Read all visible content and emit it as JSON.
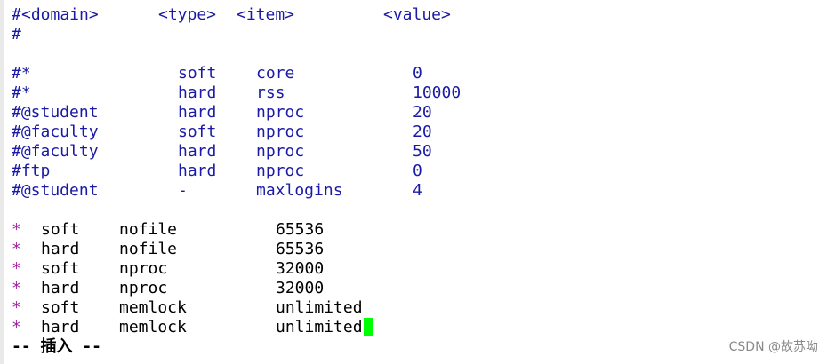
{
  "editor": {
    "partial_top": "#",
    "header": {
      "hash": "#",
      "domain": "<domain>",
      "type": "<type>",
      "item": "<item>",
      "value": "<value>"
    },
    "hash_line": "#",
    "commented_rows": [
      {
        "domain": "#*",
        "type": "soft",
        "item": "core",
        "value": "0"
      },
      {
        "domain": "#*",
        "type": "hard",
        "item": "rss",
        "value": "10000"
      },
      {
        "domain": "#@student",
        "type": "hard",
        "item": "nproc",
        "value": "20"
      },
      {
        "domain": "#@faculty",
        "type": "soft",
        "item": "nproc",
        "value": "20"
      },
      {
        "domain": "#@faculty",
        "type": "hard",
        "item": "nproc",
        "value": "50"
      },
      {
        "domain": "#ftp",
        "type": "hard",
        "item": "nproc",
        "value": "0"
      },
      {
        "domain": "#@student",
        "type": "-",
        "item": "maxlogins",
        "value": "4"
      }
    ],
    "active_rows": [
      {
        "domain": "*",
        "type": "soft",
        "item": "nofile",
        "value": "65536"
      },
      {
        "domain": "*",
        "type": "hard",
        "item": "nofile",
        "value": "65536"
      },
      {
        "domain": "*",
        "type": "soft",
        "item": "nproc",
        "value": "32000"
      },
      {
        "domain": "*",
        "type": "hard",
        "item": "nproc",
        "value": "32000"
      },
      {
        "domain": "*",
        "type": "soft",
        "item": "memlock",
        "value": "unlimited"
      },
      {
        "domain": "*",
        "type": "hard",
        "item": "memlock",
        "value": "unlimited"
      }
    ],
    "mode_text": "-- 插入 --",
    "colors": {
      "comment": "#1a1aa6",
      "star": "#a020a0",
      "text": "#000000",
      "cursor": "#00ff00"
    }
  },
  "watermark": "CSDN @故苏呦"
}
